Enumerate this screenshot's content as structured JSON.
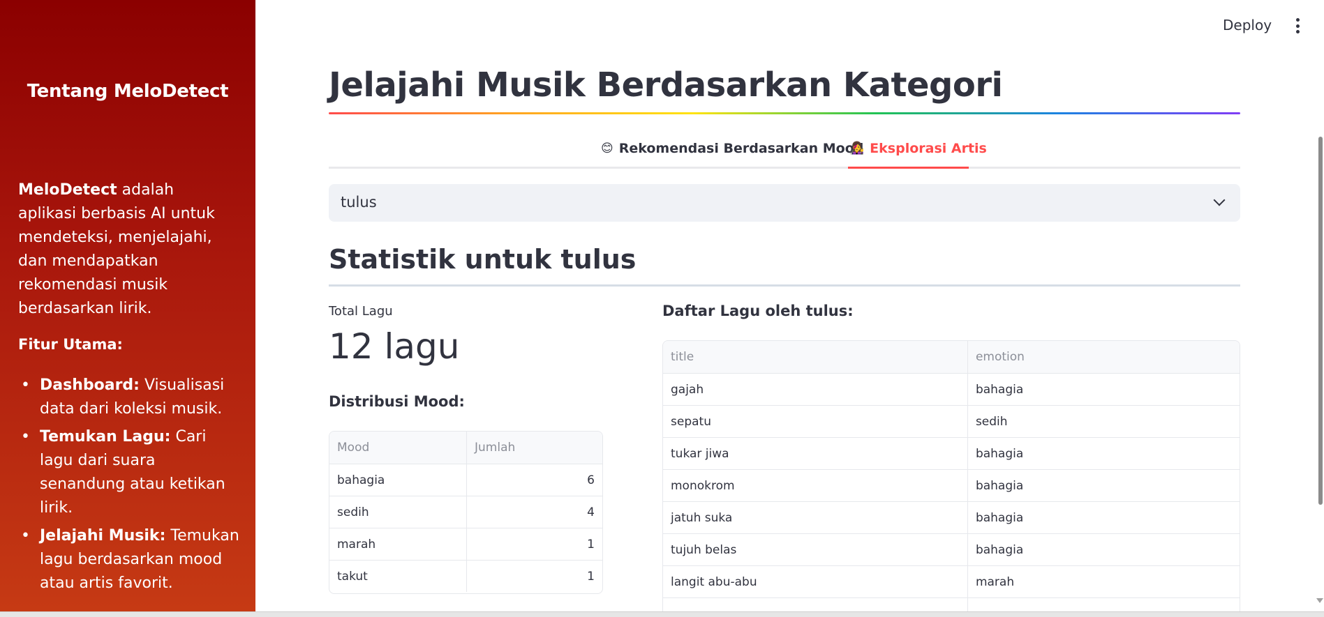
{
  "sidebar": {
    "title": "Tentang MeloDetect",
    "desc_bold": "MeloDetect",
    "desc_rest": " adalah aplikasi berbasis AI untuk mendeteksi, menjelajahi, dan mendapatkan rekomendasi musik berdasarkan lirik.",
    "features_title": "Fitur Utama:",
    "features": [
      {
        "name": "Dashboard:",
        "desc": " Visualisasi data dari koleksi musik."
      },
      {
        "name": "Temukan Lagu:",
        "desc": " Cari lagu dari suara senandung atau ketikan lirik."
      },
      {
        "name": "Jelajahi Musik:",
        "desc": " Temukan lagu berdasarkan mood atau artis favorit."
      }
    ]
  },
  "topbar": {
    "deploy_label": "Deploy",
    "menu_icon": "kebab-menu-icon"
  },
  "main": {
    "title": "Jelajahi Musik Berdasarkan Kategori",
    "tabs": [
      {
        "emoji": "😊",
        "label": "Rekomendasi Berdasarkan Mood",
        "active": false
      },
      {
        "emoji": "👩‍🎤",
        "label": "Eksplorasi Artis",
        "active": true
      }
    ],
    "artist_select": {
      "value": "tulus"
    },
    "stat_title": "Statistik untuk tulus",
    "metric": {
      "label": "Total Lagu",
      "value": "12 lagu"
    },
    "mood_title": "Distribusi Mood:",
    "mood_table": {
      "columns": [
        "Mood",
        "Jumlah"
      ],
      "rows": [
        [
          "bahagia",
          "6"
        ],
        [
          "sedih",
          "4"
        ],
        [
          "marah",
          "1"
        ],
        [
          "takut",
          "1"
        ]
      ]
    },
    "songs_title": "Daftar Lagu oleh tulus:",
    "songs_table": {
      "columns": [
        "title",
        "emotion"
      ],
      "rows": [
        [
          "gajah",
          "bahagia"
        ],
        [
          "sepatu",
          "sedih"
        ],
        [
          "tukar jiwa",
          "bahagia"
        ],
        [
          "monokrom",
          "bahagia"
        ],
        [
          "jatuh suka",
          "bahagia"
        ],
        [
          "tujuh belas",
          "bahagia"
        ],
        [
          "langit abu-abu",
          "marah"
        ]
      ]
    }
  },
  "colors": {
    "accent": "#ff4b4b",
    "sidebar_top": "#8b0000",
    "sidebar_bottom": "#c63a14",
    "text": "#31333f"
  }
}
